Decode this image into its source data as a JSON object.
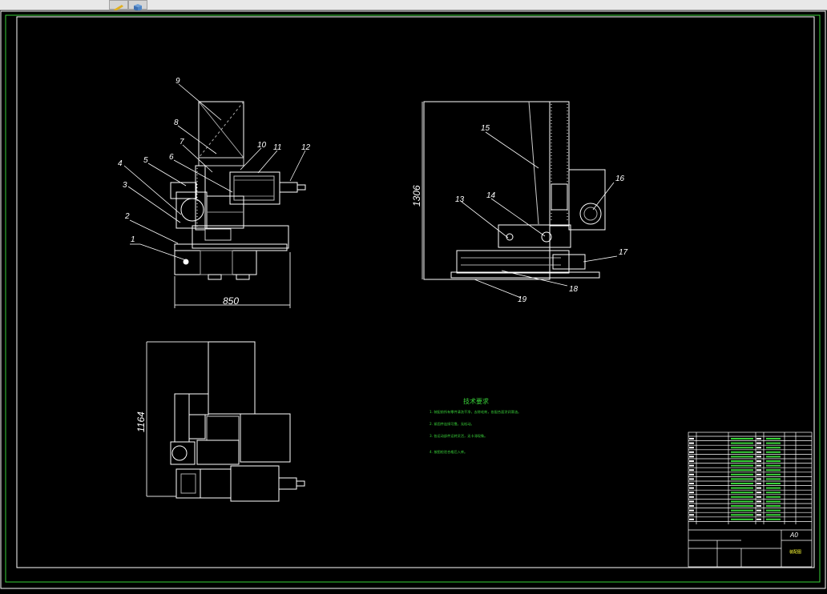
{
  "toolbar": {
    "icons": [
      "pen-icon",
      "cube-icon"
    ]
  },
  "drawing": {
    "frame_color": "#ffffff",
    "border_color": "#39d239",
    "part_numbers_front": [
      "1",
      "2",
      "3",
      "4",
      "5",
      "6",
      "7",
      "8",
      "9",
      "10",
      "11",
      "12"
    ],
    "part_numbers_side": [
      "13",
      "14",
      "15",
      "16",
      "17",
      "18",
      "19"
    ],
    "dimensions": {
      "front_width": "850",
      "side_height": "1306",
      "top_height": "1164"
    },
    "tech_requirements": {
      "title": "技术要求",
      "lines": [
        "1. 装配前所有零件清洗干净，去除毛刺，各配合面涂润滑油。",
        "2. 紧固件连接可靠，无松动。",
        "3. 各运动部件运转灵活，无卡滞现象。",
        "4. 按图检验合格后入库。"
      ]
    },
    "title_block": {
      "sheet_size": "A0",
      "drawing_name": "装配图"
    }
  }
}
